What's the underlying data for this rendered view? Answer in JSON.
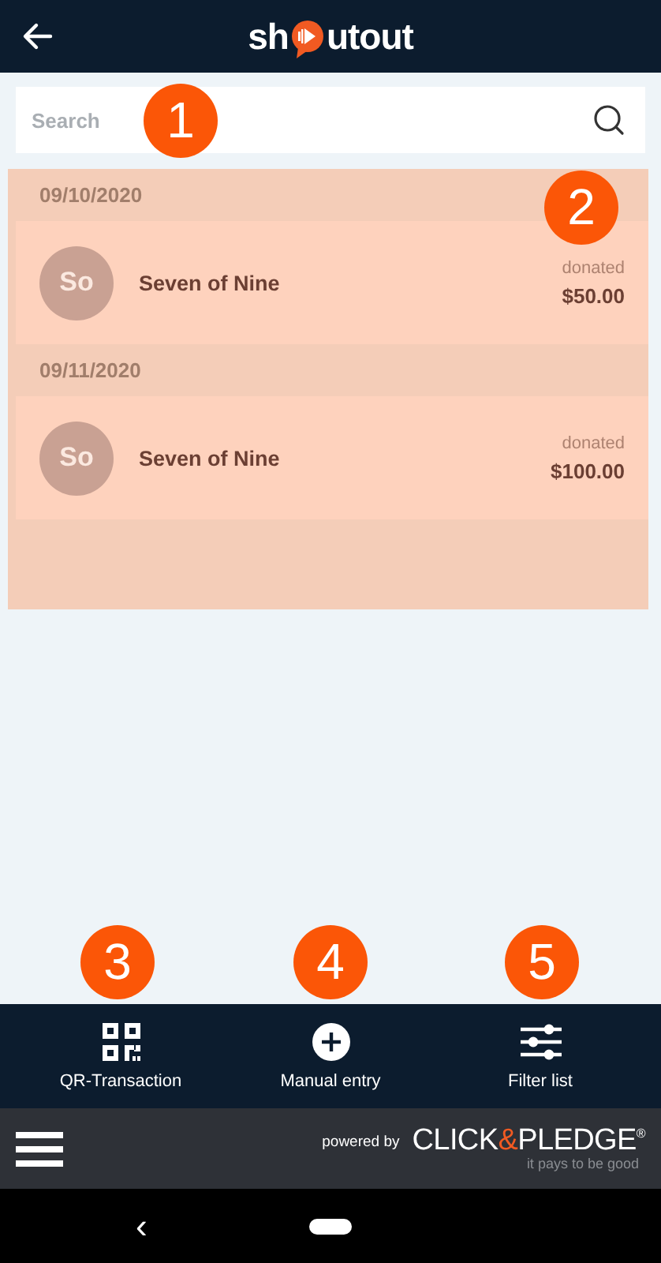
{
  "header": {
    "logo_left": "sh",
    "logo_right": "utout"
  },
  "search": {
    "placeholder": "Search"
  },
  "groups": [
    {
      "date": "09/10/2020",
      "donations": [
        {
          "initials": "So",
          "name": "Seven of Nine",
          "label": "donated",
          "amount": "$50.00"
        }
      ]
    },
    {
      "date": "09/11/2020",
      "donations": [
        {
          "initials": "So",
          "name": "Seven of Nine",
          "label": "donated",
          "amount": "$100.00"
        }
      ]
    }
  ],
  "actions": [
    {
      "kind": "qr",
      "label": "QR-Transaction"
    },
    {
      "kind": "plus",
      "label": "Manual entry"
    },
    {
      "kind": "sliders",
      "label": "Filter list"
    }
  ],
  "footer": {
    "powered_by": "powered by",
    "brand": [
      "CLICK",
      "&",
      "PLEDGE"
    ],
    "registered": "®",
    "tagline": "it pays to be good"
  },
  "nav": {
    "back": "‹"
  },
  "callouts": [
    "1",
    "2",
    "3",
    "4",
    "5"
  ]
}
